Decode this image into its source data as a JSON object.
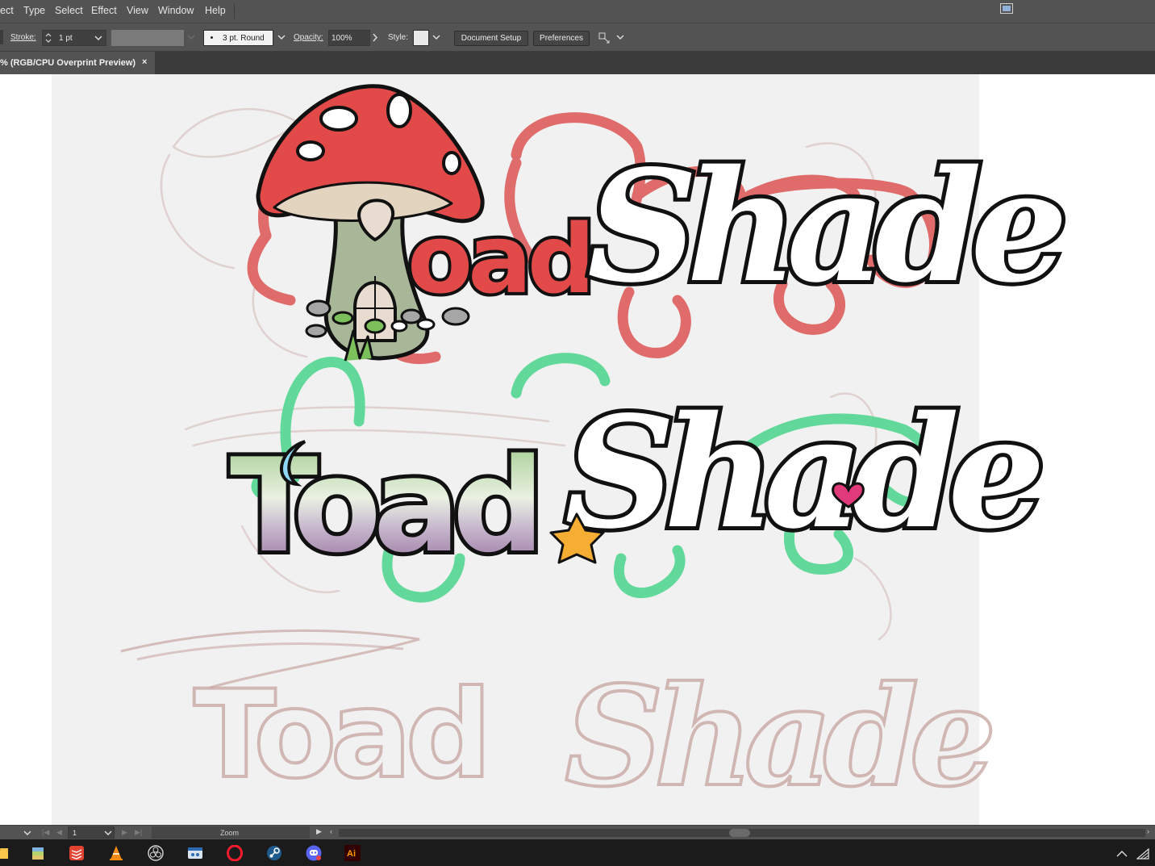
{
  "menu": {
    "items": [
      "ect",
      "Type",
      "Select",
      "Effect",
      "View",
      "Window",
      "Help"
    ]
  },
  "control_bar": {
    "stroke_label": "Stroke:",
    "stroke_value": "1 pt",
    "brush_value": "3 pt. Round",
    "opacity_label": "Opacity:",
    "opacity_value": "100%",
    "style_label": "Style:",
    "document_setup_label": "Document Setup",
    "preferences_label": "Preferences"
  },
  "document_tab": {
    "title": "% (RGB/CPU Overprint Preview)",
    "close_glyph": "×"
  },
  "artwork": {
    "logo_top_words": [
      "oad",
      "Shade"
    ],
    "logo_middle_words": [
      "Toad",
      "Shade"
    ],
    "sketch_words": [
      "Toad",
      "Shade"
    ],
    "colors": {
      "red_outline": "#df6b6b",
      "green_outline": "#62d99a",
      "mushroom_red": "#e24a4a",
      "sketch": "#c9a9a5",
      "star": "#f6ad33",
      "moon": "#8fd8f5",
      "heart": "#e03a7a"
    }
  },
  "status_bar": {
    "page_value": "1",
    "zoom_label": "Zoom"
  },
  "taskbar": {
    "apps": [
      "file-explorer",
      "archive-app",
      "todoist",
      "vlc",
      "obs",
      "media-app",
      "opera",
      "steam",
      "discord",
      "illustrator"
    ],
    "illustrator_label": "Ai"
  }
}
